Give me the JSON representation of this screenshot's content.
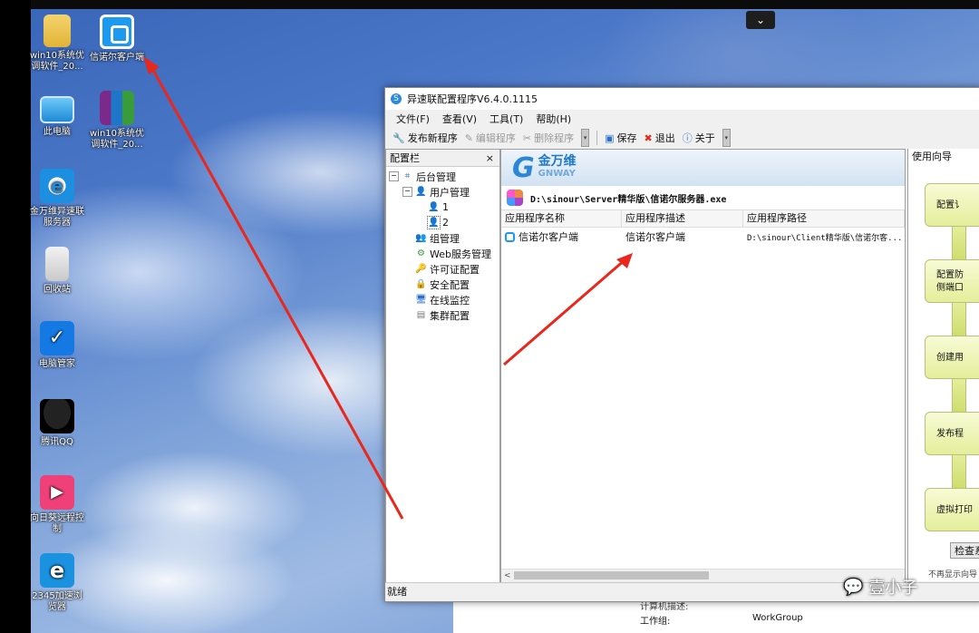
{
  "desktop": {
    "icons": [
      {
        "name": "win10-folder",
        "label": "win10系统优\n调软件_20..."
      },
      {
        "name": "sinour-client-shortcut",
        "label": "信诺尔客户端"
      },
      {
        "name": "this-pc",
        "label": "此电脑"
      },
      {
        "name": "win10-archive",
        "label": "win10系统优\n调软件_20..."
      },
      {
        "name": "gnway-server",
        "label": "金万维异速联\n服务器"
      },
      {
        "name": "recycle-bin",
        "label": "回收站"
      },
      {
        "name": "pc-manager",
        "label": "电脑管家"
      },
      {
        "name": "qq",
        "label": "腾讯QQ"
      },
      {
        "name": "remote-control",
        "label": "向日葵远程控\n制"
      },
      {
        "name": "browser-2345",
        "label": "2345加速浏\n览器"
      }
    ]
  },
  "window": {
    "title": "异速联配置程序V6.4.0.1115",
    "menu": [
      "文件(F)",
      "查看(V)",
      "工具(T)",
      "帮助(H)"
    ],
    "toolbar": {
      "publish": "发布新程序",
      "edit": "编辑程序",
      "delete": "删除程序",
      "save": "保存",
      "exit": "退出",
      "about": "关于"
    },
    "left_panel": {
      "title": "配置栏",
      "close": "×",
      "tree": {
        "root": "后台管理",
        "user_mgmt": "用户管理",
        "user1": "1",
        "user2": "2",
        "group_mgmt": "组管理",
        "web_service": "Web服务管理",
        "license": "许可证配置",
        "security": "安全配置",
        "online": "在线监控",
        "cluster": "集群配置"
      }
    },
    "center": {
      "logo_cn": "金万维",
      "logo_en": "GNWAY",
      "server_path": "D:\\sinour\\Server精华版\\信诺尔服务器.exe",
      "columns": [
        "应用程序名称",
        "应用程序描述",
        "应用程序路径"
      ],
      "rows": [
        {
          "name": "信诺尔客户端",
          "desc": "信诺尔客户端",
          "path": "D:\\sinour\\Client精华版\\信诺尔客..."
        }
      ]
    },
    "right_panel": {
      "title": "使用向导",
      "steps": [
        "配置讠",
        "配置防\n侧端口",
        "创建用",
        "发布程",
        "虚拟打印"
      ],
      "check_button": "检查系",
      "footer_text": "不再显示向导"
    },
    "status": "就绪"
  },
  "background_window": {
    "label1": "计算机描述:",
    "label2": "工作组:",
    "value2": "WorkGroup"
  },
  "watermark": "壹小子"
}
